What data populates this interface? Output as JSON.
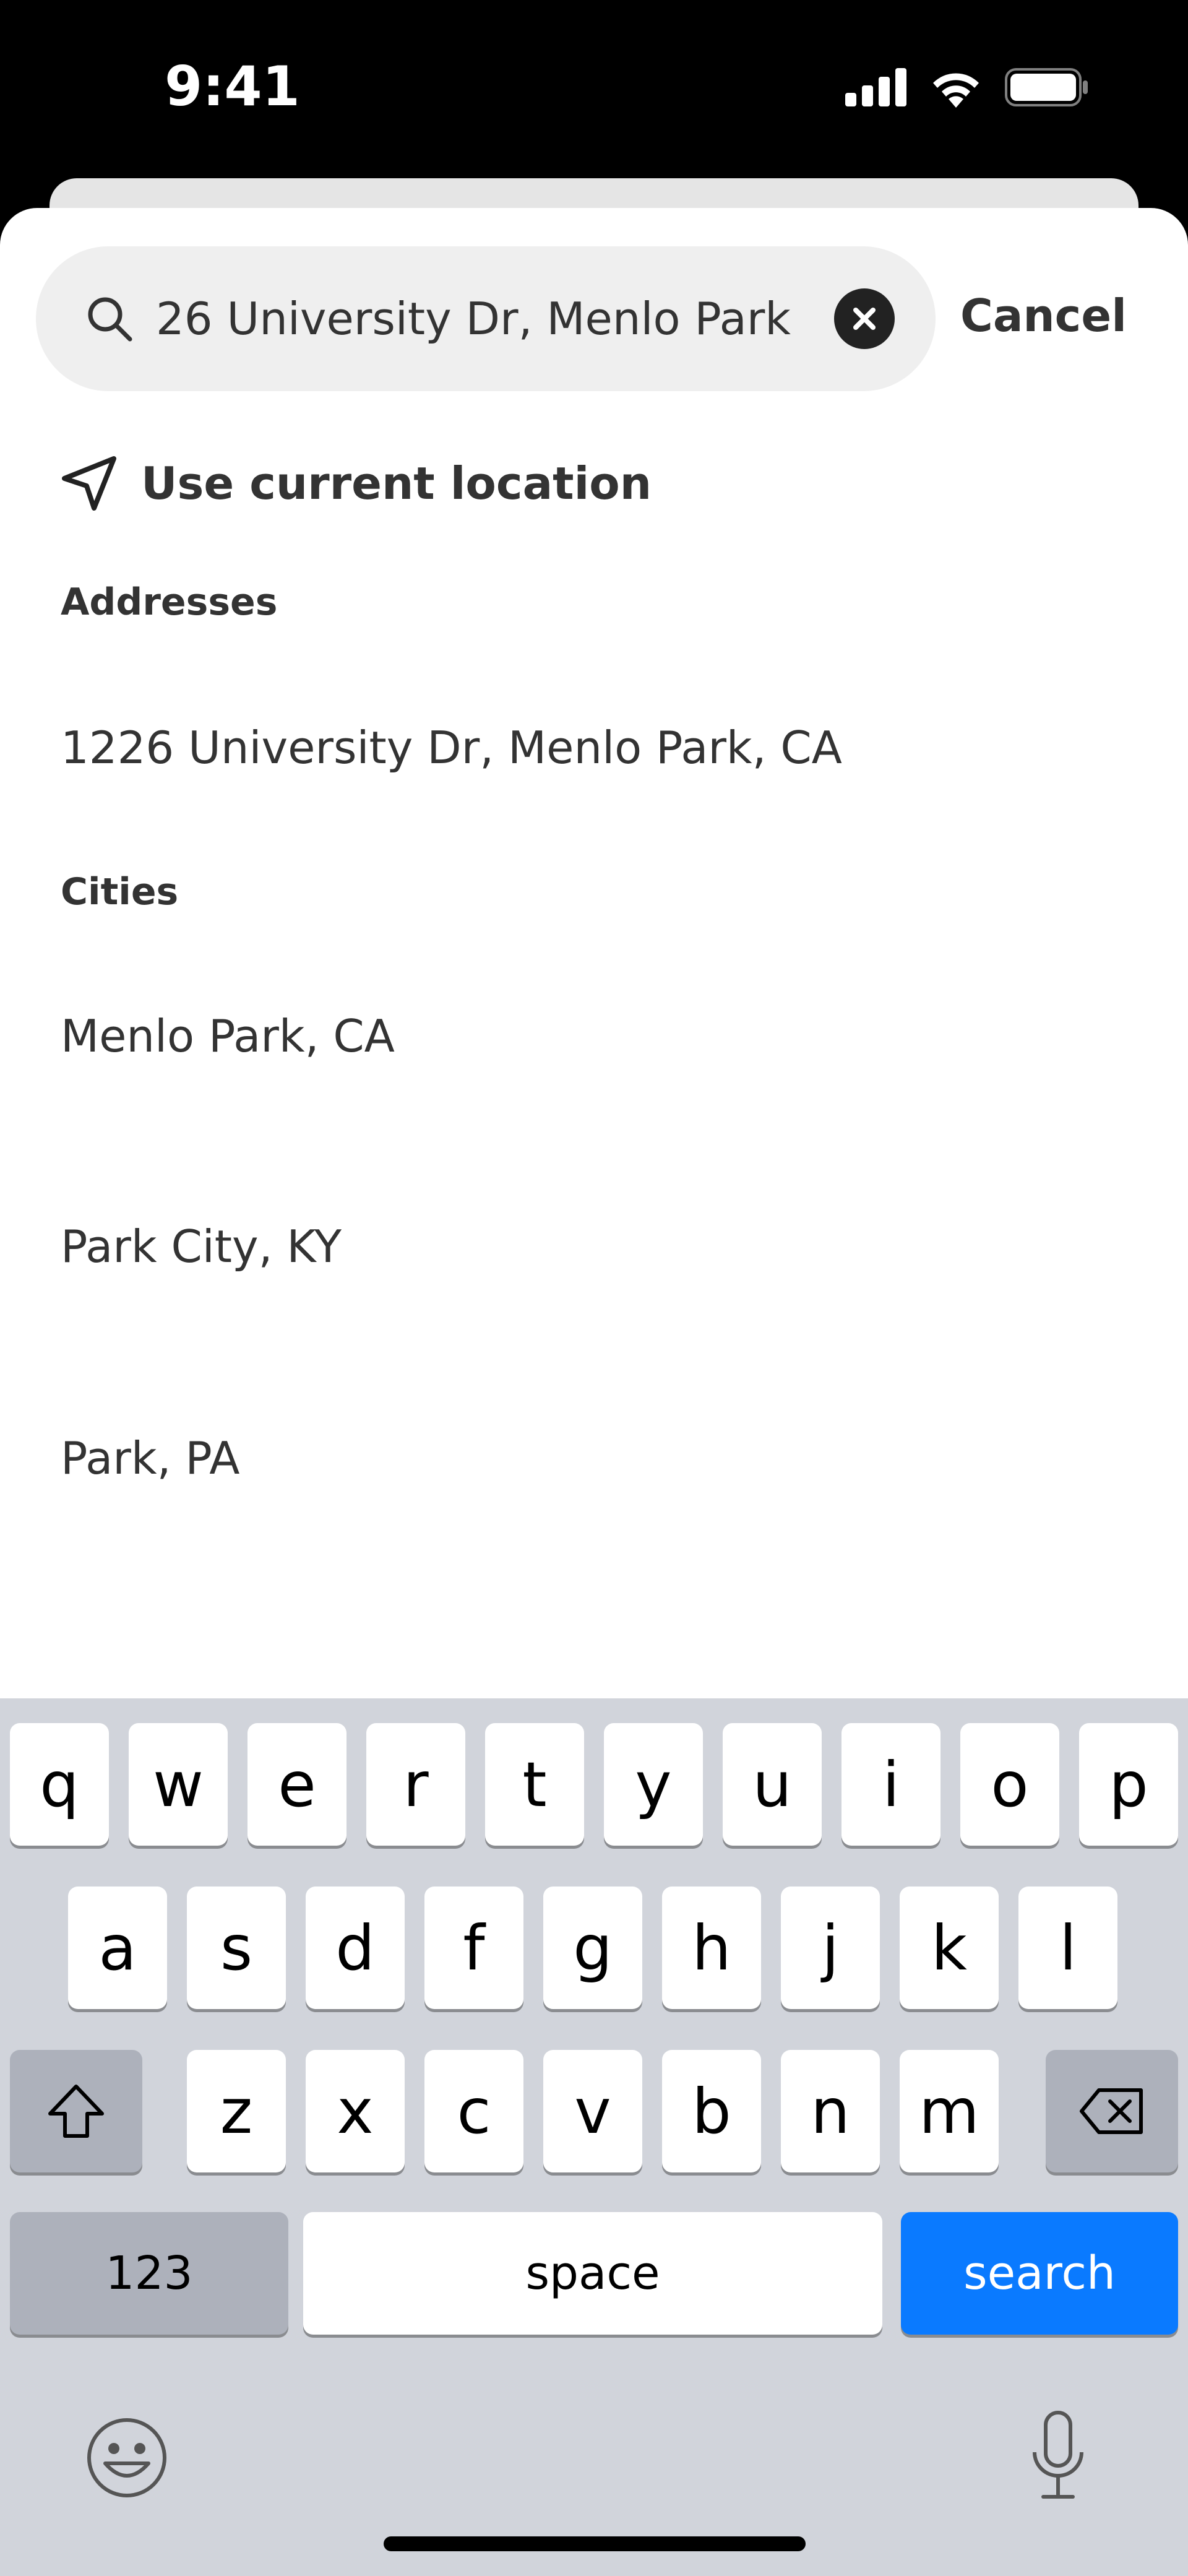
{
  "status_bar": {
    "time": "9:41"
  },
  "search": {
    "value": "26 University Dr, Menlo Park",
    "cancel_label": "Cancel"
  },
  "current_location": {
    "label": "Use current location"
  },
  "sections": {
    "addresses": {
      "header": "Addresses",
      "items": [
        "1226 University Dr, Menlo Park, CA"
      ]
    },
    "cities": {
      "header": "Cities",
      "items": [
        "Menlo Park, CA",
        "Park City, KY",
        "Park, PA"
      ]
    }
  },
  "keyboard": {
    "row1": [
      "q",
      "w",
      "e",
      "r",
      "t",
      "y",
      "u",
      "i",
      "o",
      "p"
    ],
    "row2": [
      "a",
      "s",
      "d",
      "f",
      "g",
      "h",
      "j",
      "k",
      "l"
    ],
    "row3": [
      "z",
      "x",
      "c",
      "v",
      "b",
      "n",
      "m"
    ],
    "numbers_label": "123",
    "space_label": "space",
    "search_label": "search"
  },
  "colors": {
    "accent": "#0a7aff",
    "keyboard_bg": "#d1d4db"
  }
}
